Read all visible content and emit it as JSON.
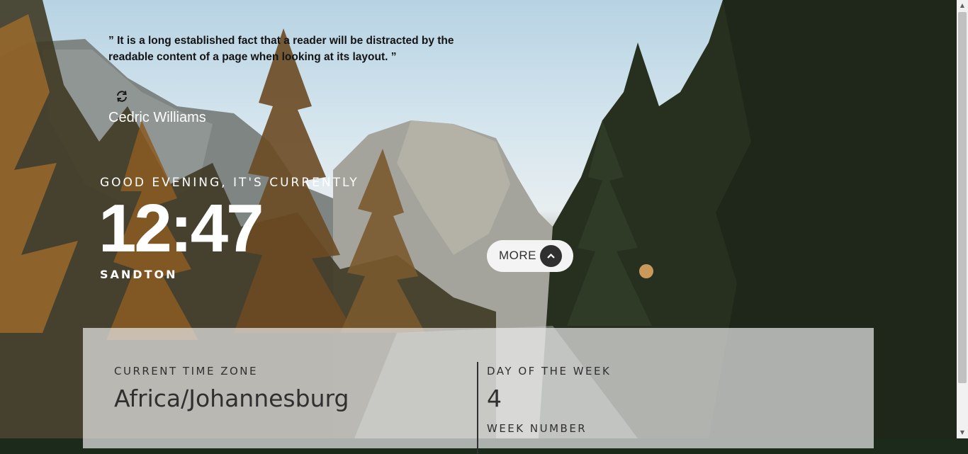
{
  "quote": {
    "open_mark": "”",
    "text": "It is a long established fact that a reader will be distracted by the readable content of a page when looking at its layout.",
    "close_mark": "”",
    "author": "Cedric Williams"
  },
  "greeting": "GOOD EVENING, IT'S CURRENTLY",
  "time": "12:47",
  "location": "SANDTON",
  "more_button": {
    "label": "MORE",
    "icon": "chevron-up-icon"
  },
  "refresh_icon": "refresh-icon",
  "panel": {
    "timezone_label": "CURRENT TIME ZONE",
    "timezone_value": "Africa/Johannesburg",
    "day_label": "DAY OF THE WEEK",
    "day_value": "4",
    "week_label": "WEEK NUMBER"
  },
  "colors": {
    "text_dark": "#303030",
    "panel_bg": "#e6e6e6",
    "button_bg": "#f4f4f4",
    "white": "#ffffff"
  }
}
